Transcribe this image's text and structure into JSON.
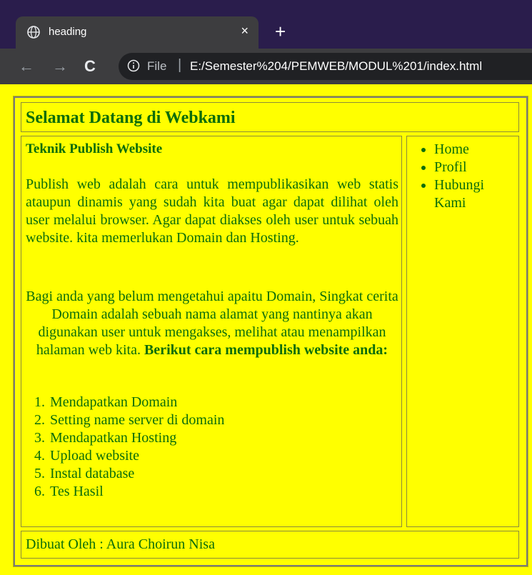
{
  "browser": {
    "tab_title": "heading",
    "tab_close": "×",
    "new_tab": "+",
    "back": "←",
    "forward": "→",
    "reload": "C",
    "scheme": "File",
    "separator": "|",
    "url": "E:/Semester%204/PEMWEB/MODUL%201/index.html"
  },
  "page": {
    "heading": "Selamat Datang di Webkami",
    "content_title": "Teknik Publish Website",
    "paragraph1": "Publish web adalah cara untuk mempublikasikan web statis ataupun dinamis yang sudah kita buat agar dapat dilihat oleh user melalui browser. Agar dapat diakses oleh user untuk sebuah website. kita memerlukan Domain dan Hosting.",
    "paragraph2": "Bagi anda yang belum mengetahui apaitu Domain, Singkat cerita Domain adalah sebuah nama alamat yang nantinya akan digunakan user untuk mengakses, melihat atau menampilkan halaman web kita.",
    "paragraph2_bold": "Berikut cara mempublish website anda:",
    "steps": [
      "Mendapatkan Domain",
      "Setting name server di domain",
      "Mendapatkan Hosting",
      "Upload website",
      "Instal database",
      "Tes Hasil"
    ],
    "nav": [
      "Home",
      "Profil",
      "Hubungi Kami"
    ],
    "footer": "Dibuat Oleh : Aura Choirun Nisa"
  },
  "colors": {
    "page_background": "#ffff00",
    "text": "#0b6d0b",
    "browser_frame": "#2a1d4c"
  }
}
